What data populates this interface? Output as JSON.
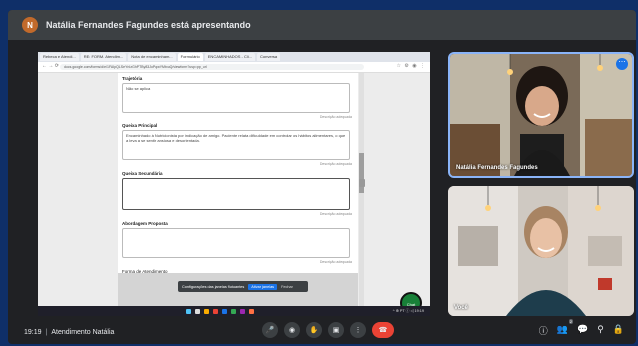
{
  "presenter_banner": {
    "avatar_letter": "N",
    "text": "Natália Fernandes Fagundes está apresentando"
  },
  "browser": {
    "tabs": [
      "Rebeca e Atendi...",
      "RE: FORM. Atendim...",
      "Nota de encaminham...",
      "Formulário",
      "ENCAMINHADOS - Cli...",
      "Conversa"
    ],
    "active_tab_index": 3,
    "nav_symbols": "←  →  ⟳",
    "url": "docs.google.com/forms/d/e/1FAIpQLSeYnIzGhPTBy83JoPqwYMtxuQ/viewform?usp=pp_url",
    "extension_symbols": "☆ ⚙ ◉ ⋮"
  },
  "form": {
    "fields": [
      {
        "label": "Trajetória",
        "value": "Não se aplica",
        "note": "Descrição adequada"
      },
      {
        "label": "Queixa Principal",
        "value": "Encaminhado à Nutricionista por indicação de amigo. Paciente relata dificuldade em controlar os hábitos alimentares, o que a leva a se sentir ansiosa e desorientada.",
        "note": "Descrição adequada"
      },
      {
        "label": "Queixa Secundária",
        "value": "",
        "note": "Descrição adequada"
      },
      {
        "label": "Abordagem Proposta",
        "value": "",
        "note": "Descrição adequada"
      }
    ],
    "radio_group_label": "Forma de Atendimento",
    "radio_option": "Não se aplica"
  },
  "toast": {
    "text": "Configurações das janelas flutuantes",
    "button": "Ativar janelas",
    "dismiss": "Fechar"
  },
  "chat_fab_label": "Chat",
  "taskbar_tray": "^ ⊕ PT ⓘ ◁ 19:19",
  "participants": [
    {
      "name": "Natália Fernandes Fagundes",
      "options_symbol": "⋯"
    },
    {
      "name": "Você"
    }
  ],
  "bottom_bar": {
    "time": "19:19",
    "meeting_name": "Atendimento Natália",
    "controls": [
      {
        "name": "microphone",
        "symbol": "🎤"
      },
      {
        "name": "camera",
        "symbol": "◉"
      },
      {
        "name": "raise-hand",
        "symbol": "✋"
      },
      {
        "name": "present",
        "symbol": "▣"
      },
      {
        "name": "more",
        "symbol": "⋮"
      }
    ],
    "end_call_symbol": "☎",
    "right_controls": [
      {
        "name": "info",
        "symbol": "ⓘ"
      },
      {
        "name": "people",
        "symbol": "👥",
        "badge": "2"
      },
      {
        "name": "chat",
        "symbol": "💬"
      },
      {
        "name": "activities",
        "symbol": "⚲"
      },
      {
        "name": "host-controls",
        "symbol": "🔒"
      }
    ]
  }
}
